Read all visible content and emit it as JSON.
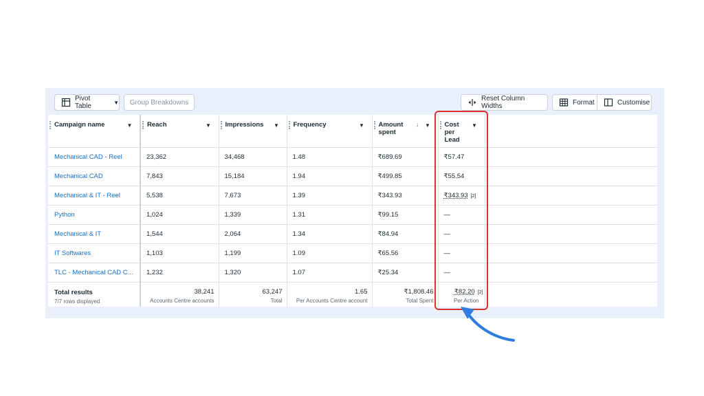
{
  "toolbar": {
    "pivot_table_label": "Pivot Table",
    "group_breakdowns_label": "Group Breakdowns",
    "reset_column_widths_label": "Reset Column Widths",
    "format_label": "Format",
    "customise_label": "Customise"
  },
  "table": {
    "columns": [
      {
        "label": "Campaign name"
      },
      {
        "label": "Reach"
      },
      {
        "label": "Impressions"
      },
      {
        "label": "Frequency"
      },
      {
        "label": "Amount spent"
      },
      {
        "label": "Cost per Lead"
      }
    ],
    "rows": [
      {
        "name": "Mechanical CAD - Reel",
        "reach": "23,362",
        "impressions": "34,468",
        "frequency": "1.48",
        "amount": "₹689.69",
        "cpl": "₹57.47"
      },
      {
        "name": "Mechanical CAD",
        "reach": "7,843",
        "impressions": "15,184",
        "frequency": "1.94",
        "amount": "₹499.85",
        "cpl": "₹55.54"
      },
      {
        "name": "Mechanical & IT - Reel",
        "reach": "5,538",
        "impressions": "7,673",
        "frequency": "1.39",
        "amount": "₹343.93",
        "cpl": "₹343.93",
        "cpl_footnote": "[2]"
      },
      {
        "name": "Python",
        "reach": "1,024",
        "impressions": "1,339",
        "frequency": "1.31",
        "amount": "₹99.15",
        "cpl": "—"
      },
      {
        "name": "Mechanical & IT",
        "reach": "1,544",
        "impressions": "2,064",
        "frequency": "1.34",
        "amount": "₹84.94",
        "cpl": "—"
      },
      {
        "name": "IT Softwares",
        "reach": "1,103",
        "impressions": "1,199",
        "frequency": "1.09",
        "amount": "₹65.56",
        "cpl": "—"
      },
      {
        "name": "TLC - Mechanical CAD C...",
        "reach": "1,232",
        "impressions": "1,320",
        "frequency": "1.07",
        "amount": "₹25.34",
        "cpl": "—"
      }
    ],
    "totals": {
      "title": "Total results",
      "rows_displayed": "7/7 rows displayed",
      "reach": "38,241",
      "reach_sub": "Accounts Centre accounts",
      "impressions": "63,247",
      "impressions_sub": "Total",
      "frequency": "1.65",
      "frequency_sub": "Per Accounts Centre account",
      "amount": "₹1,808.46",
      "amount_sub": "Total Spent",
      "cpl": "₹82.20",
      "cpl_footnote": "[2]",
      "cpl_sub": "Per Action"
    }
  },
  "colors": {
    "link": "#1a6ec2",
    "highlight": "#d9312b",
    "arrow": "#2f7de1",
    "panel": "#eaf0fb"
  },
  "icons": {
    "pivot": "pivot-table-icon",
    "reset": "column-width-icon",
    "format": "grid-format-icon",
    "customise": "columns-panel-icon",
    "sort": "sort-down-icon",
    "dropdown": "caret-down-icon"
  }
}
